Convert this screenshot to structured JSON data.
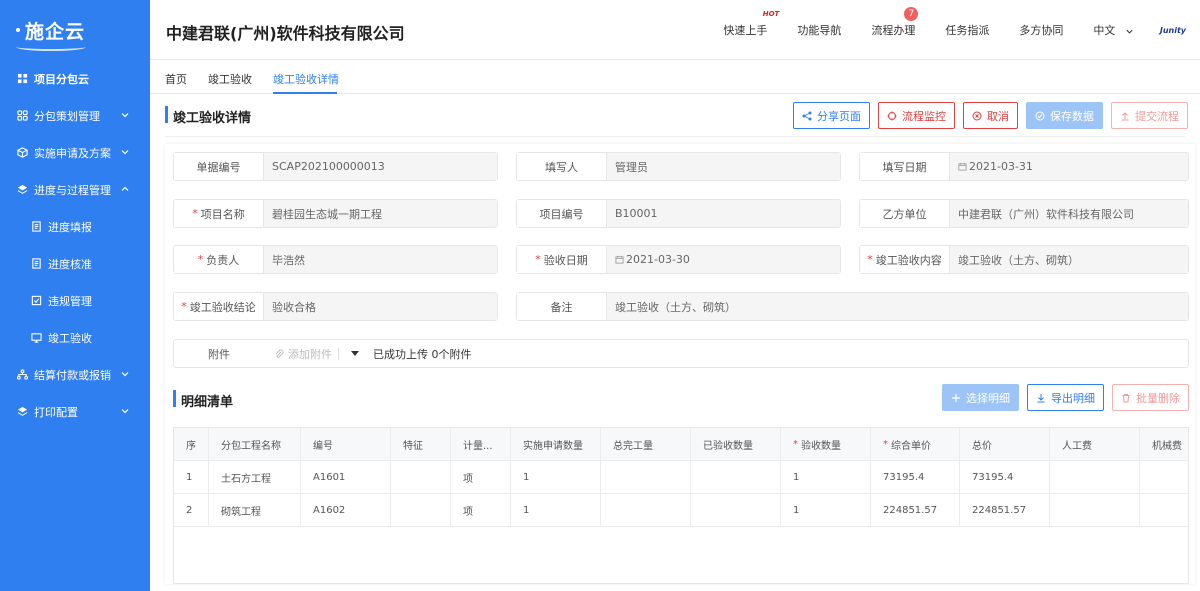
{
  "app": {
    "logo": "施企云",
    "company": "中建君联(广州)软件科技有限公司"
  },
  "sidebar": {
    "items": [
      {
        "label": "项目分包云",
        "icon": "grid-icon"
      },
      {
        "label": "分包策划管理",
        "icon": "apps-icon"
      },
      {
        "label": "实施申请及方案",
        "icon": "cube-icon"
      },
      {
        "label": "进度与过程管理",
        "icon": "layers-icon"
      },
      {
        "label": "进度填报",
        "icon": "doc-icon"
      },
      {
        "label": "进度核准",
        "icon": "doc-icon"
      },
      {
        "label": "违规管理",
        "icon": "check-icon"
      },
      {
        "label": "竣工验收",
        "icon": "monitor-icon"
      },
      {
        "label": "结算付款或报销",
        "icon": "org-icon"
      },
      {
        "label": "打印配置",
        "icon": "layers-icon"
      }
    ]
  },
  "topnav": {
    "quick_start": "快速上手",
    "hot": "HOT",
    "features": "功能导航",
    "workflow": "流程办理",
    "workflow_badge": "7",
    "tasks": "任务指派",
    "collab": "多方协同",
    "lang": "中文",
    "brand": "Junity"
  },
  "tabs": [
    "首页",
    "竣工验收",
    "竣工验收详情"
  ],
  "page": {
    "title": "竣工验收详情",
    "actions": {
      "share": "分享页面",
      "monitor": "流程监控",
      "cancel": "取消",
      "save": "保存数据",
      "submit": "提交流程"
    }
  },
  "form": {
    "doc_no_label": "单据编号",
    "doc_no": "SCAP202100000013",
    "writer_label": "填写人",
    "writer": "管理员",
    "date_label": "填写日期",
    "date": "2021-03-31",
    "project_label": "项目名称",
    "project": "碧桂园生态城一期工程",
    "project_no_label": "项目编号",
    "project_no": "B10001",
    "partyb_label": "乙方单位",
    "partyb": "中建君联（广州）软件科技有限公司",
    "owner_label": "负责人",
    "owner": "毕浩然",
    "accept_date_label": "验收日期",
    "accept_date": "2021-03-30",
    "content_label": "竣工验收内容",
    "content": "竣工验收（土方、砌筑）",
    "conclusion_label": "竣工验收结论",
    "conclusion": "验收合格",
    "remark_label": "备注",
    "remark": "竣工验收（土方、砌筑）",
    "attach_label": "附件",
    "attach_btn": "添加附件",
    "attach_status": "已成功上传 0个附件"
  },
  "detail": {
    "title": "明细清单",
    "select": "选择明细",
    "export": "导出明细",
    "delete": "批量删除",
    "columns": [
      "序",
      "分包工程名称",
      "编号",
      "特征",
      "计量...",
      "实施申请数量",
      "总完工量",
      "已验收数量",
      "验收数量",
      "综合单价",
      "总价",
      "人工费",
      "机械费"
    ],
    "rows": [
      [
        "1",
        "土石方工程",
        "A1601",
        "",
        "项",
        "1",
        "",
        "",
        "1",
        "73195.4",
        "73195.4",
        "",
        ""
      ],
      [
        "2",
        "砌筑工程",
        "A1602",
        "",
        "项",
        "1",
        "",
        "",
        "1",
        "224851.57",
        "224851.57",
        "",
        ""
      ]
    ]
  }
}
